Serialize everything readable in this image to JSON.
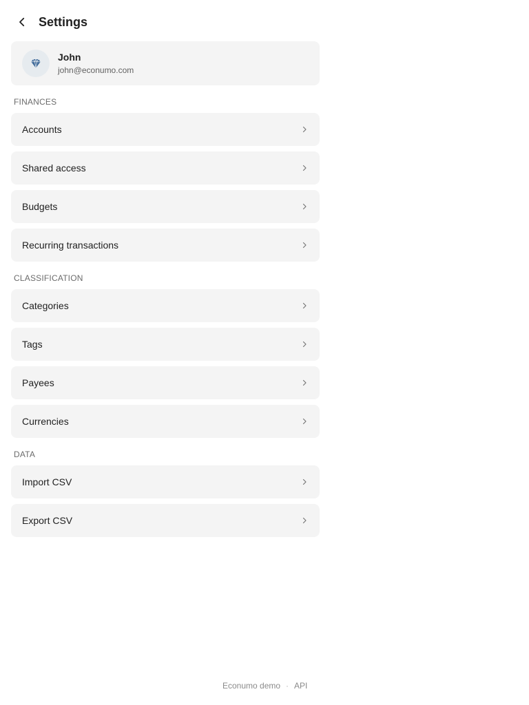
{
  "header": {
    "title": "Settings",
    "back_icon": "chevron-left-icon"
  },
  "profile": {
    "name": "John",
    "email": "john@econumo.com",
    "avatar_icon": "diamond-icon"
  },
  "sections": [
    {
      "label": "FINANCES",
      "items": [
        {
          "label": "Accounts"
        },
        {
          "label": "Shared access"
        },
        {
          "label": "Budgets"
        },
        {
          "label": "Recurring transactions"
        }
      ]
    },
    {
      "label": "CLASSIFICATION",
      "items": [
        {
          "label": "Categories"
        },
        {
          "label": "Tags"
        },
        {
          "label": "Payees"
        },
        {
          "label": "Currencies"
        }
      ]
    },
    {
      "label": "DATA",
      "items": [
        {
          "label": "Import CSV"
        },
        {
          "label": "Export CSV"
        }
      ]
    }
  ],
  "footer": {
    "demo_link": "Econumo demo",
    "separator": "·",
    "api_link": "API"
  },
  "colors": {
    "card_bg": "#f4f4f4",
    "avatar_bg": "#e6ebef",
    "avatar_icon": "#3f6a9a",
    "muted_text": "#6b6b6b"
  }
}
